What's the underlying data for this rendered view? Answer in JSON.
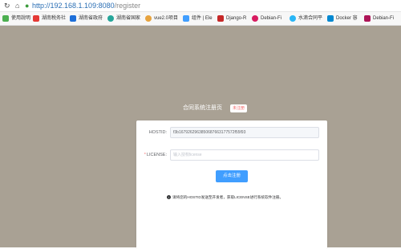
{
  "browser": {
    "url_host": "http://192.168.1.109:8080",
    "url_path": "/register",
    "bookmarks": [
      {
        "label": "使用說明",
        "icon_color": "#4caf50"
      },
      {
        "label": "湖南税务社",
        "icon_color": "#e53935"
      },
      {
        "label": "湖南省政府",
        "icon_color": "#1e6fd9"
      },
      {
        "label": "湖南省国家",
        "icon_color": "#26a69a"
      },
      {
        "label": "vue2.0项目",
        "icon_color": "#e7a33e"
      },
      {
        "label": "组件 | Ele",
        "icon_color": "#409eff"
      },
      {
        "label": "Django-R",
        "icon_color": "#c62828"
      },
      {
        "label": "Debian-Fi",
        "icon_color": "#d81b60"
      },
      {
        "label": "水滴合同平",
        "icon_color": "#29b6f6"
      },
      {
        "label": "Docker 容",
        "icon_color": "#0288d1"
      },
      {
        "label": "Debian-Fi",
        "icon_color": "#ad1457"
      }
    ]
  },
  "page": {
    "title": "合同系统注册页",
    "status_badge": "未注册"
  },
  "form": {
    "hostid_label": "HOSTID:",
    "hostid_value": "f3b1679262963850687663177572f55f93",
    "license_required_mark": "*",
    "license_label": "LICENSE:",
    "license_placeholder": "输入授权license",
    "submit_label": "点击注册",
    "notice": "请将您的HOSTID发送至开发者，获取LICENSE进行系统软件注册。"
  },
  "colors": {
    "page_background": "#a9a194",
    "primary": "#409eff",
    "danger": "#f56c6c"
  }
}
